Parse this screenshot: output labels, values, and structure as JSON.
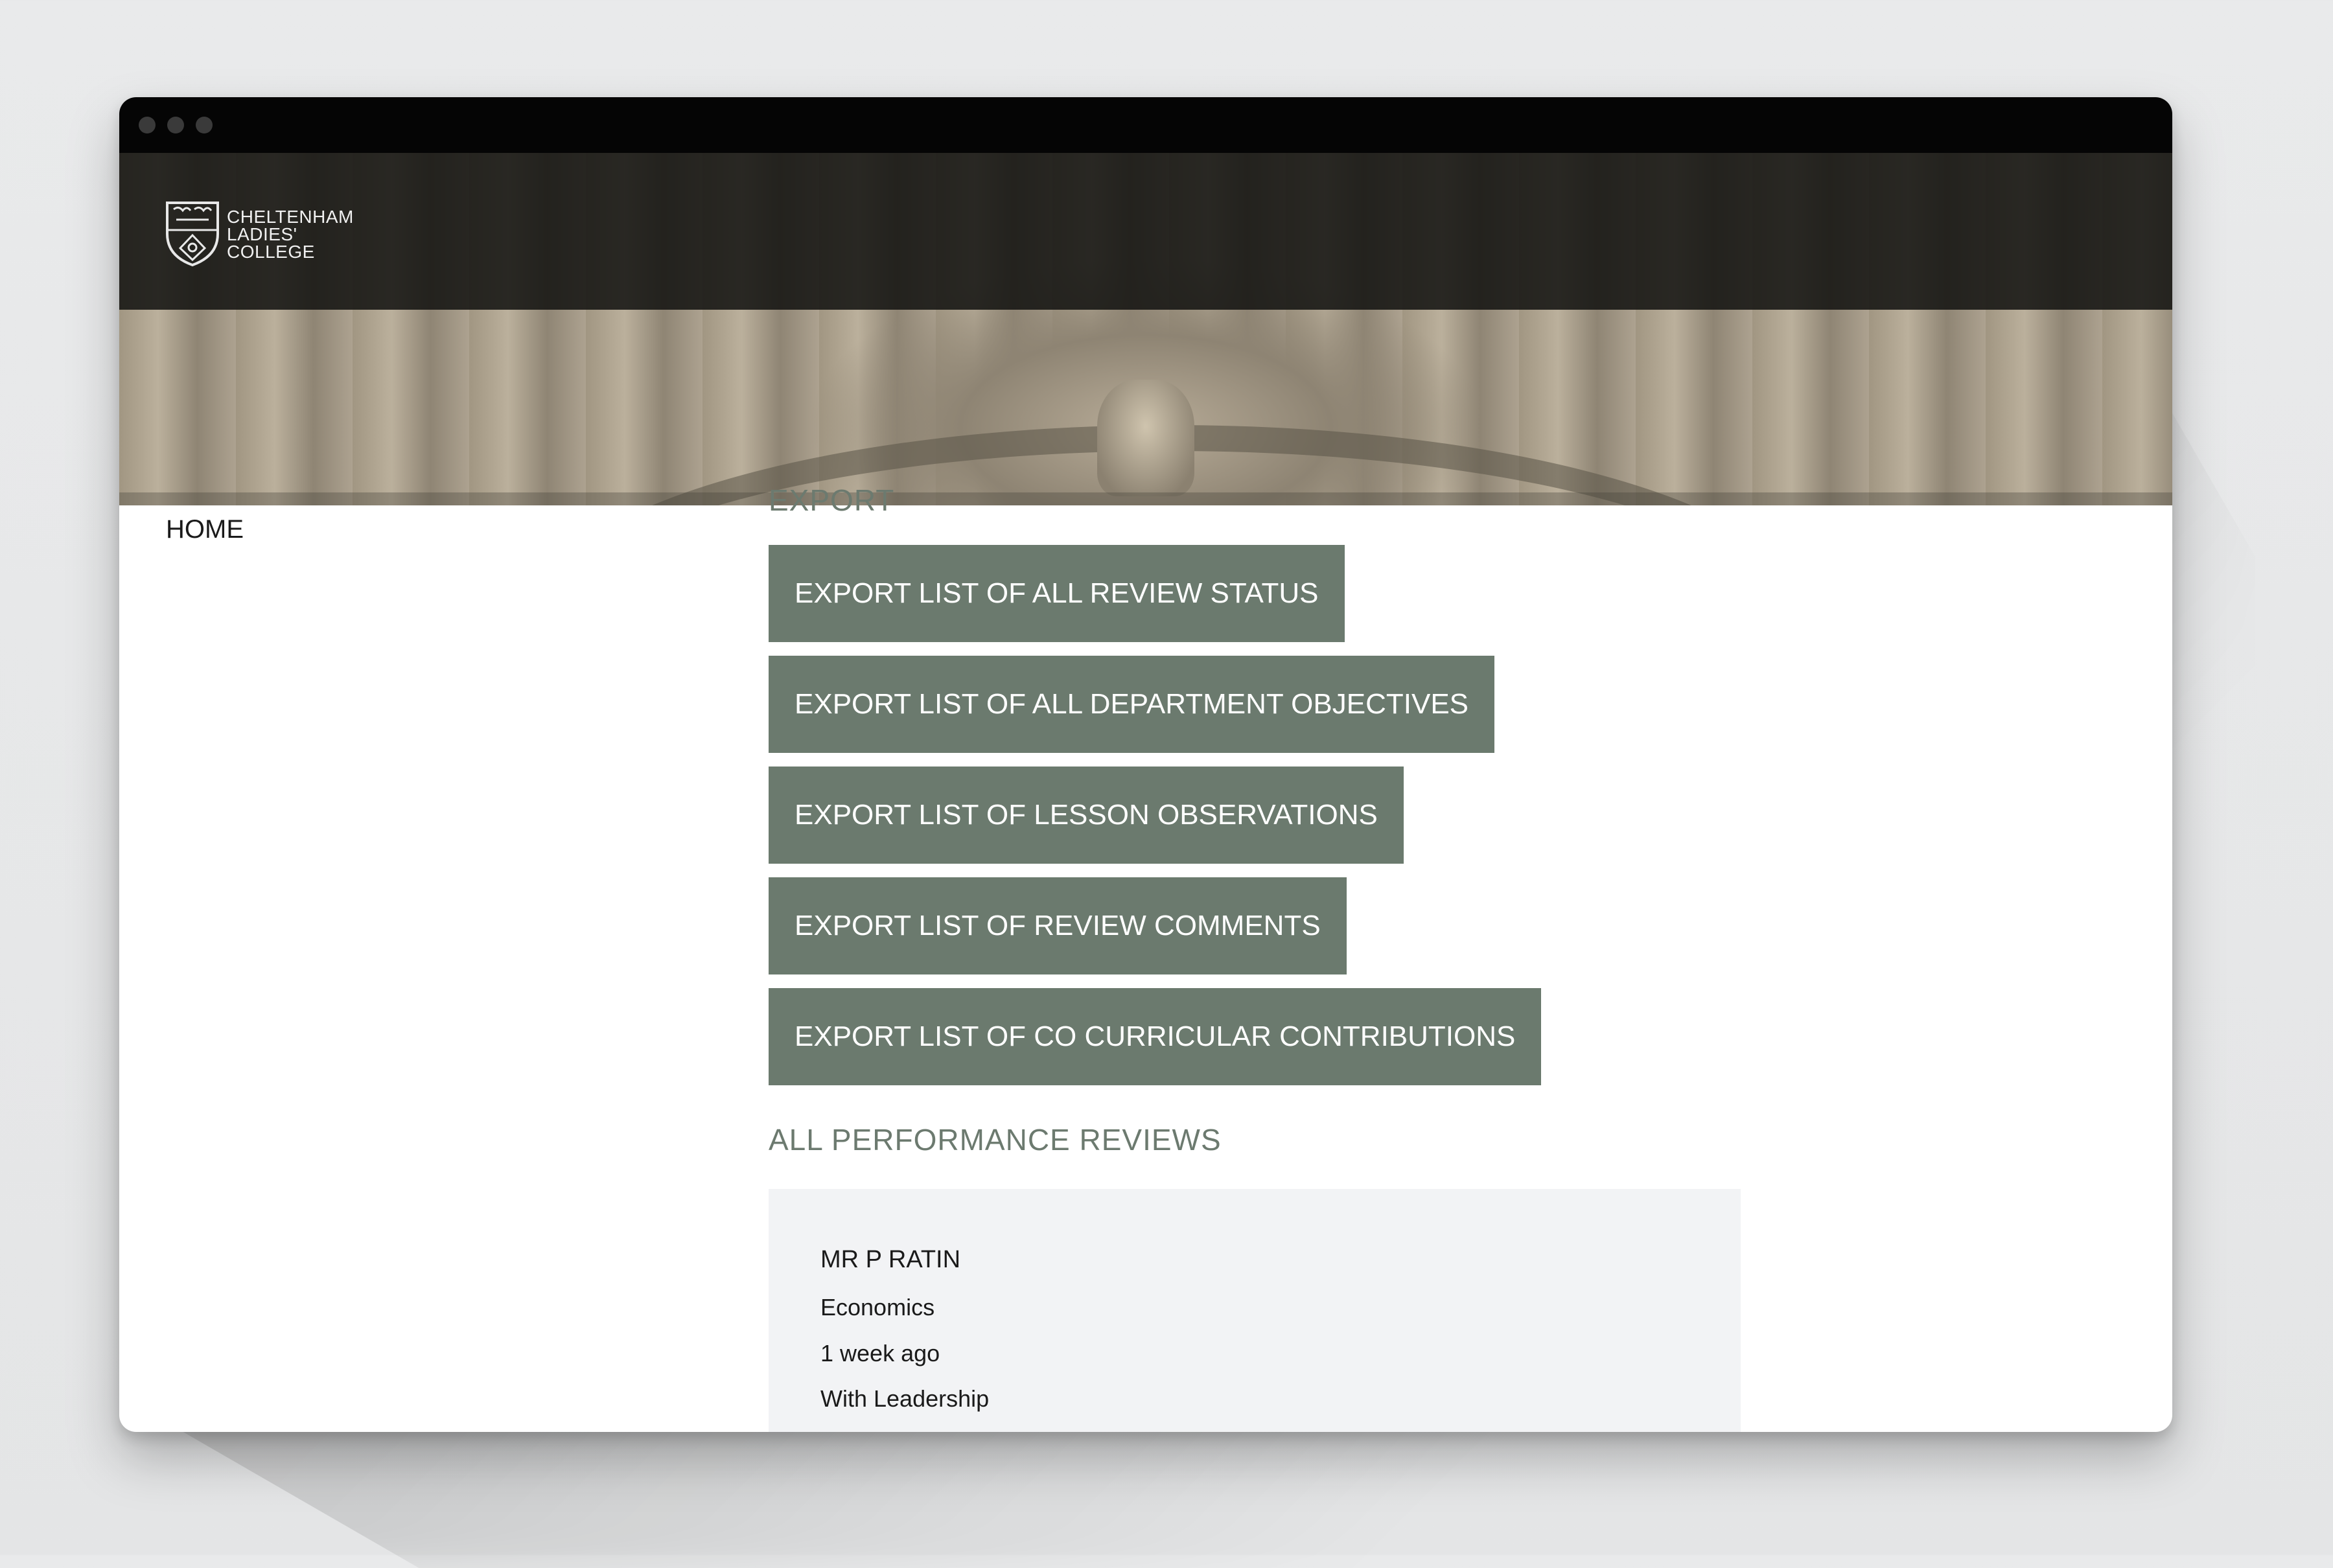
{
  "brand": {
    "logo_lines": [
      "CHELTENHAM",
      "LADIES'",
      "COLLEGE"
    ]
  },
  "nav": {
    "home_label": "HOME"
  },
  "export": {
    "heading": "EXPORT",
    "buttons": [
      {
        "label": "EXPORT LIST OF ALL REVIEW STATUS"
      },
      {
        "label": "EXPORT LIST OF ALL DEPARTMENT OBJECTIVES"
      },
      {
        "label": "EXPORT LIST OF LESSON OBSERVATIONS"
      },
      {
        "label": "EXPORT LIST OF REVIEW COMMENTS"
      },
      {
        "label": "EXPORT LIST OF CO CURRICULAR CONTRIBUTIONS"
      }
    ]
  },
  "reviews": {
    "heading": "ALL PERFORMANCE REVIEWS",
    "items": [
      {
        "name": "MR P RATIN",
        "department": "Economics",
        "time": "1 week ago",
        "status": "With Leadership"
      }
    ]
  },
  "colors": {
    "button_bg": "#6b7a6e",
    "heading": "#6c7a6f",
    "card_bg": "#f2f3f5",
    "header_band": "#141412"
  }
}
